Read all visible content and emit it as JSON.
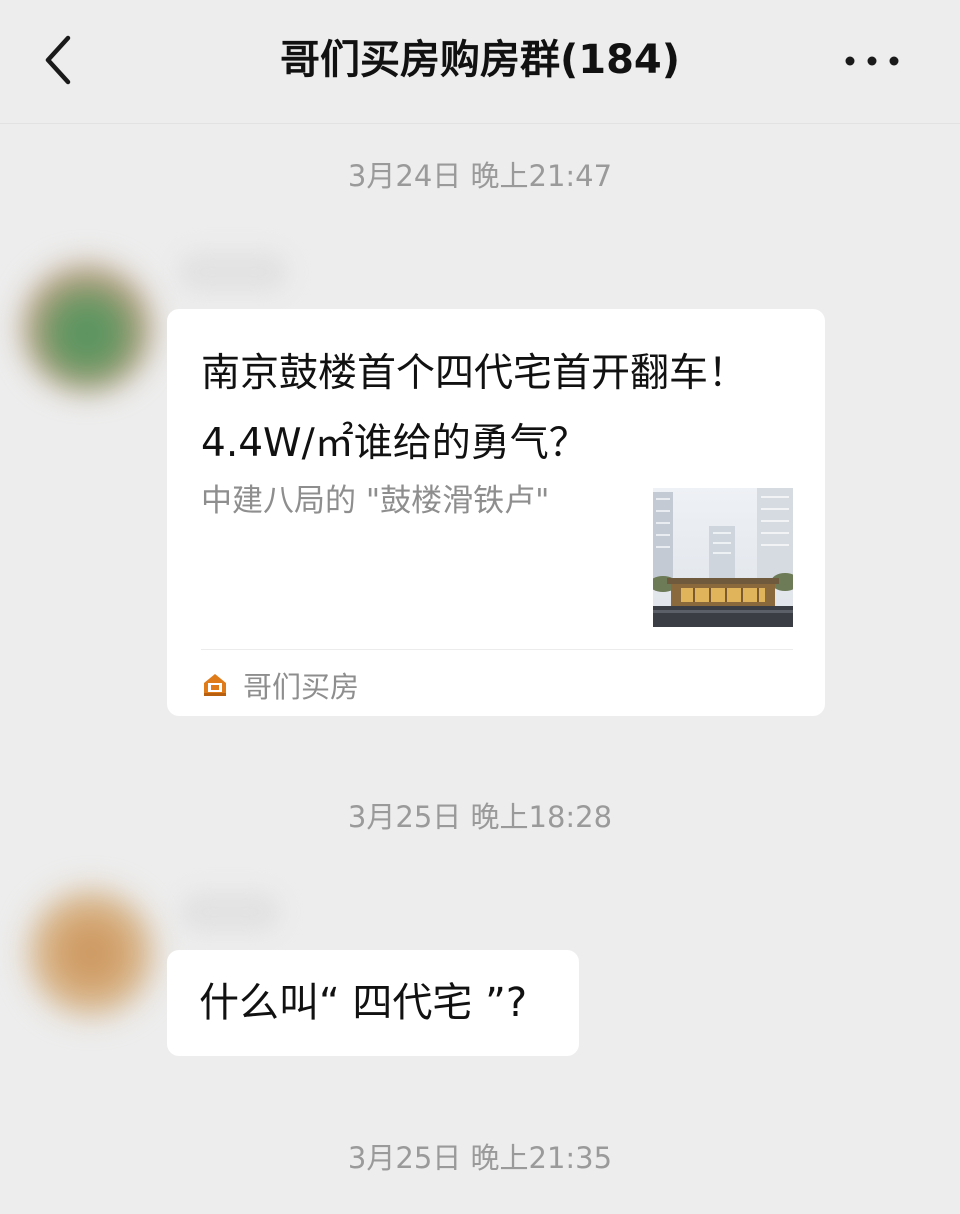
{
  "header": {
    "title": "哥们买房购房群(184)",
    "back_icon": "chevron-left-icon",
    "more_icon": "more-dots-icon"
  },
  "messages": [
    {
      "timestamp": "3月24日 晚上21:47",
      "type": "link-card",
      "card": {
        "title": "南京鼓楼首个四代宅首开翻车！4.4W/㎡谁给的勇气？",
        "description": "中建八局的 \"鼓楼滑铁卢\"",
        "source_name": "哥们买房",
        "source_icon": "account-logo-icon",
        "thumbnail": "building-thumbnail"
      }
    },
    {
      "timestamp": "3月25日 晚上18:28",
      "type": "text",
      "text": "什么叫“ 四代宅 ”?"
    },
    {
      "timestamp": "3月25日 晚上21:35"
    }
  ],
  "colors": {
    "background": "#ededed",
    "bubble": "#ffffff",
    "timestamp": "#9a9a9a",
    "secondary_text": "#8e8e8e",
    "logo_orange": "#e07b1a"
  }
}
